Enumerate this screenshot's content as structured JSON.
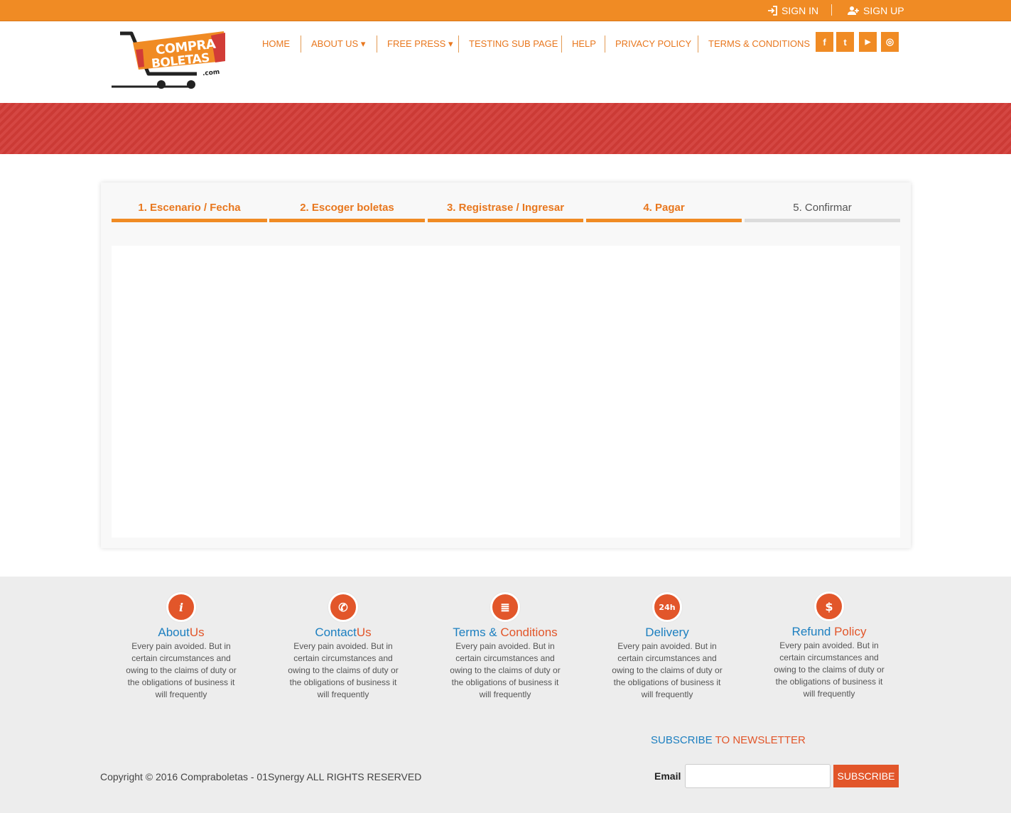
{
  "topbar": {
    "signin_label": "SIGN IN",
    "signup_label": "SIGN UP"
  },
  "header": {
    "logo": {
      "line1": "COMPRA",
      "line2": "BOLETAS",
      "suffix": ".com"
    },
    "nav": [
      {
        "label": "HOME"
      },
      {
        "label": "ABOUT US ▾"
      },
      {
        "label": "FREE PRESS ▾"
      },
      {
        "label": "TESTING SUB PAGE"
      },
      {
        "label": "HELP"
      },
      {
        "label": "PRIVACY POLICY"
      },
      {
        "label": "TERMS & CONDITIONS"
      }
    ],
    "social": [
      {
        "icon": "facebook-icon",
        "glyph": "f"
      },
      {
        "icon": "twitter-icon",
        "glyph": "t"
      },
      {
        "icon": "youtube-icon",
        "glyph": "▶"
      },
      {
        "icon": "instagram-icon",
        "glyph": "◎"
      }
    ]
  },
  "steps": [
    {
      "label": "1. Escenario / Fecha",
      "state": "done"
    },
    {
      "label": "2. Escoger boletas",
      "state": "done"
    },
    {
      "label": "3. Registrase / Ingresar",
      "state": "done"
    },
    {
      "label": "4. Pagar",
      "state": "done"
    },
    {
      "label": "5. Confirmar",
      "state": "pending"
    }
  ],
  "footer": {
    "features": [
      {
        "title_a": "About",
        "title_b": "Us",
        "icon": "info-icon",
        "glyph": "i",
        "desc": "Every pain avoided. But in certain circumstances and owing to the claims of duty or the obligations of business it will frequently"
      },
      {
        "title_a": "Contact",
        "title_b": "Us",
        "icon": "phone-icon",
        "glyph": "✆",
        "desc": "Every pain avoided. But in certain circumstances and owing to the claims of duty or the obligations of business it will frequently"
      },
      {
        "title_a": "Terms & ",
        "title_b": "Conditions",
        "icon": "document-icon",
        "glyph": "≣",
        "desc": "Every pain avoided. But in certain circumstances and owing to the claims of duty or the obligations of business it will frequently"
      },
      {
        "title_a": "Delivery",
        "title_b": "",
        "icon": "delivery-truck-icon",
        "glyph": "24h",
        "desc": "Every pain avoided. But in certain circumstances and owing to the claims of duty or the obligations of business it will frequently"
      },
      {
        "title_a": "Refund ",
        "title_b": "Policy",
        "icon": "dollar-icon",
        "glyph": "$",
        "desc": "Every pain avoided. But in certain circumstances and owing to the claims of duty or the obligations of business it will frequently"
      }
    ],
    "newsletter": {
      "title_a": "SUBSCRIBE",
      "title_b": " TO NEWSLETTER",
      "email_label": "Email",
      "email_value": "",
      "button_label": "SUBSCRIBE"
    },
    "copyright": "Copyright © 2016 Compraboletas - 01Synergy ALL RIGHTS RESERVED"
  },
  "colors": {
    "accent": "#f08b24",
    "banner": "#d23c37",
    "link_blue": "#1c7fc0",
    "accent_dark": "#e2562a"
  }
}
